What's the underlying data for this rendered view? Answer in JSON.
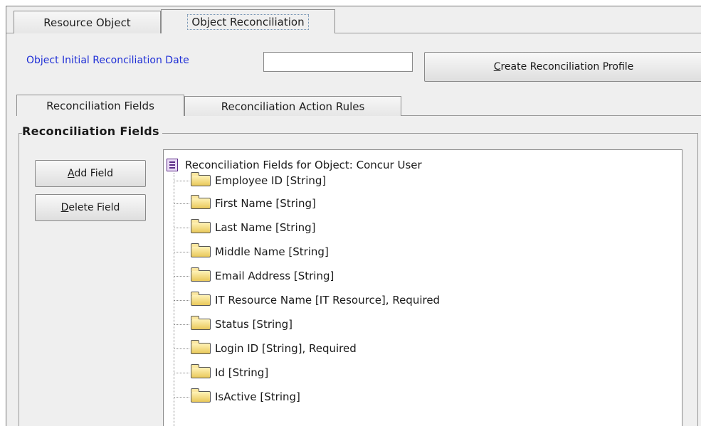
{
  "top_tabs": [
    {
      "label": "Resource Object",
      "selected": false
    },
    {
      "label": "Object Reconciliation",
      "selected": true
    }
  ],
  "recon_date": {
    "label": "Object Initial Reconciliation Date",
    "value": "",
    "placeholder": ""
  },
  "create_button": {
    "mnemonic": "C",
    "rest": "reate Reconciliation Profile"
  },
  "inner_tabs": [
    {
      "label": "Reconciliation Fields",
      "selected": true
    },
    {
      "label": "Reconciliation Action Rules",
      "selected": false
    }
  ],
  "group_title": "Reconciliation Fields",
  "add_button": {
    "mnemonic": "A",
    "rest": "dd Field"
  },
  "delete_button": {
    "mnemonic": "D",
    "rest": "elete Field"
  },
  "tree": {
    "root_label": "Reconciliation Fields for Object: Concur User",
    "items": [
      "Employee ID [String]",
      "First Name [String]",
      "Last Name [String]",
      "Middle Name [String]",
      "Email Address [String]",
      "IT Resource Name [IT Resource], Required",
      "Status [String]",
      "Login ID [String], Required",
      "Id [String]",
      "IsActive [String]"
    ]
  },
  "icons": {
    "root": "reconciliation-object-icon",
    "item": "folder-icon"
  },
  "colors": {
    "label_blue": "#1f2fd6",
    "panel_bg": "#efefef"
  }
}
